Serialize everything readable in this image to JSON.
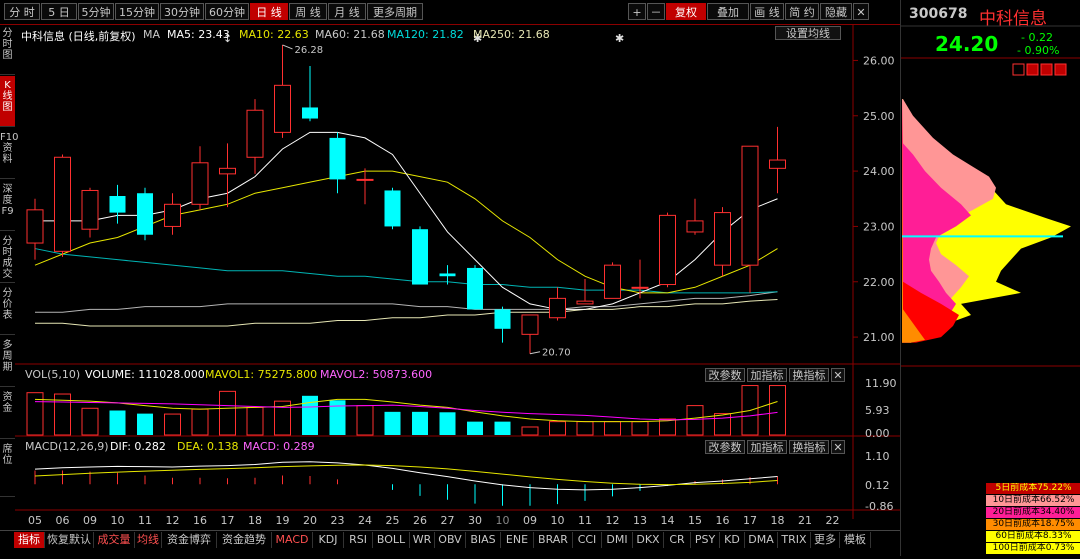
{
  "toolbar": {
    "left": [
      "分 时",
      "5 日",
      "5分钟",
      "15分钟",
      "30分钟",
      "60分钟",
      "日 线",
      "周 线",
      "月 线",
      "更多周期"
    ],
    "right": [
      "+",
      "－",
      "复权",
      "叠加",
      "画 线",
      "简 约",
      "隐藏",
      "✕"
    ],
    "active_left": "日 线"
  },
  "leftbar": [
    "分时图",
    "K线图",
    "F10资料",
    "深度F9",
    "分时成交",
    "分价表",
    "多周期",
    "资金",
    "席位"
  ],
  "legend": {
    "title": "中科信息 (日线,前复权)",
    "ma": "MA",
    "ma5": "MA5: 23.43",
    "ma10": "MA10: 22.63",
    "ma60": "MA60: 21.68",
    "ma120": "MA120: 21.82",
    "ma250": "MA250: 21.68",
    "settings": "设置均线"
  },
  "vol_legend": {
    "name": "VOL(5,10)",
    "volume": "VOLUME: 111028.000",
    "mavol1": "MAVOL1: 75275.800",
    "mavol2": "MAVOL2: 50873.600"
  },
  "macd_legend": {
    "name": "MACD(12,26,9)",
    "dif": "DIF: 0.282",
    "dea": "DEA: 0.138",
    "macd": "MACD: 0.289"
  },
  "panel_buttons": {
    "params": "改参数",
    "add": "加指标",
    "switch": "换指标",
    "close": "✕"
  },
  "annotations": {
    "high": "26.28",
    "low": "20.70"
  },
  "price_axis": [
    "26.00",
    "25.00",
    "24.00",
    "23.00",
    "22.00",
    "21.00"
  ],
  "vol_axis": [
    "11.90",
    "5.93",
    "0.00"
  ],
  "macd_axis": [
    "1.10",
    "0.12",
    "-0.86"
  ],
  "dates": [
    "05",
    "06",
    "09",
    "10",
    "11",
    "12",
    "16",
    "17",
    "18",
    "19",
    "20",
    "23",
    "24",
    "25",
    "26",
    "27",
    "30",
    "10",
    "09",
    "10",
    "11",
    "12",
    "13",
    "14",
    "15",
    "16",
    "17",
    "18",
    "21",
    "22"
  ],
  "bottom_tabs": [
    "指标",
    "恢复默认",
    "成交量",
    "均线",
    "资金博弈",
    "资金趋势",
    "MACD",
    "KDJ",
    "RSI",
    "BOLL",
    "WR",
    "OBV",
    "BIAS",
    "ENE",
    "BRAR",
    "CCI",
    "DMI",
    "DKX",
    "CR",
    "PSY",
    "KD",
    "DMA",
    "TRIX",
    "更多",
    "模板"
  ],
  "stock": {
    "code": "300678",
    "name": "中科信息",
    "price": "24.20",
    "change": "- 0.22",
    "pct": "- 0.90%"
  },
  "cost_legend": [
    "5日前成本75.22%",
    "10日前成本66.52%",
    "20日前成本34.40%",
    "30日前成本18.75%",
    "60日前成本8.33%",
    "100日前成本0.73%"
  ],
  "colors": {
    "up": "#ff3030",
    "down": "#00ffff",
    "accent": "#c00000",
    "ma5": "#ffffff",
    "ma10": "#e6e600",
    "ma60": "#00b4b4",
    "ma120": "#b4b4b4",
    "ma250": "#e6e6b4",
    "mavol2": "#ff00ff"
  },
  "chart_data": {
    "type": "candlestick",
    "candles": [
      {
        "date": "05",
        "o": 22.7,
        "h": 23.5,
        "l": 22.4,
        "c": 23.3
      },
      {
        "date": "06",
        "o": 22.55,
        "h": 24.3,
        "l": 22.45,
        "c": 24.25
      },
      {
        "date": "09",
        "o": 22.95,
        "h": 23.7,
        "l": 22.8,
        "c": 23.65
      },
      {
        "date": "10",
        "o": 23.55,
        "h": 23.75,
        "l": 23.05,
        "c": 23.25
      },
      {
        "date": "11",
        "o": 23.6,
        "h": 23.7,
        "l": 22.75,
        "c": 22.85
      },
      {
        "date": "12",
        "o": 23.0,
        "h": 23.6,
        "l": 22.85,
        "c": 23.4
      },
      {
        "date": "16",
        "o": 23.4,
        "h": 24.45,
        "l": 23.3,
        "c": 24.15
      },
      {
        "date": "17",
        "o": 23.95,
        "h": 24.5,
        "l": 23.35,
        "c": 24.05
      },
      {
        "date": "18",
        "o": 24.25,
        "h": 25.3,
        "l": 23.95,
        "c": 25.1
      },
      {
        "date": "19",
        "o": 24.7,
        "h": 26.28,
        "l": 24.6,
        "c": 25.55
      },
      {
        "date": "20",
        "o": 25.15,
        "h": 25.9,
        "l": 24.9,
        "c": 24.95
      },
      {
        "date": "23",
        "o": 24.6,
        "h": 24.7,
        "l": 23.6,
        "c": 23.85
      },
      {
        "date": "24",
        "o": 23.85,
        "h": 24.05,
        "l": 23.4,
        "c": 23.85
      },
      {
        "date": "25",
        "o": 23.65,
        "h": 23.7,
        "l": 22.95,
        "c": 23.0
      },
      {
        "date": "26",
        "o": 22.95,
        "h": 23.0,
        "l": 21.95,
        "c": 21.95
      },
      {
        "date": "27",
        "o": 22.15,
        "h": 22.3,
        "l": 21.95,
        "c": 22.1
      },
      {
        "date": "30",
        "o": 22.25,
        "h": 22.3,
        "l": 21.5,
        "c": 21.5
      },
      {
        "date": "10",
        "o": 21.5,
        "h": 21.55,
        "l": 20.9,
        "c": 21.15
      },
      {
        "date": "09",
        "o": 21.05,
        "h": 21.4,
        "l": 20.7,
        "c": 21.4
      },
      {
        "date": "10",
        "o": 21.35,
        "h": 21.9,
        "l": 21.3,
        "c": 21.7
      },
      {
        "date": "11",
        "o": 21.6,
        "h": 22.05,
        "l": 21.6,
        "c": 21.65
      },
      {
        "date": "12",
        "o": 21.7,
        "h": 22.35,
        "l": 21.7,
        "c": 22.3
      },
      {
        "date": "13",
        "o": 21.9,
        "h": 22.4,
        "l": 21.7,
        "c": 21.9
      },
      {
        "date": "14",
        "o": 21.95,
        "h": 23.25,
        "l": 21.9,
        "c": 23.2
      },
      {
        "date": "15",
        "o": 22.9,
        "h": 23.5,
        "l": 22.85,
        "c": 23.1
      },
      {
        "date": "16",
        "o": 22.3,
        "h": 23.35,
        "l": 22.1,
        "c": 23.25
      },
      {
        "date": "17",
        "o": 22.3,
        "h": 24.45,
        "l": 21.8,
        "c": 24.45
      },
      {
        "date": "18",
        "o": 24.05,
        "h": 24.8,
        "l": 23.6,
        "c": 24.2
      }
    ],
    "ma5": [
      23.1,
      23.1,
      23.1,
      23.2,
      23.2,
      23.3,
      23.5,
      23.6,
      23.9,
      24.4,
      24.7,
      24.7,
      24.6,
      24.3,
      23.6,
      22.9,
      22.4,
      21.9,
      21.6,
      21.5,
      21.5,
      21.6,
      21.8,
      22.0,
      22.4,
      22.9,
      23.3,
      23.5
    ],
    "ma10": [
      22.3,
      22.5,
      22.7,
      22.8,
      23.0,
      23.2,
      23.3,
      23.4,
      23.6,
      23.7,
      23.8,
      23.9,
      24.0,
      24.0,
      23.9,
      23.8,
      23.5,
      23.1,
      22.8,
      22.4,
      22.1,
      21.9,
      21.8,
      21.8,
      21.9,
      22.1,
      22.3,
      22.6
    ],
    "ma60": [
      22.6,
      22.5,
      22.45,
      22.4,
      22.35,
      22.3,
      22.25,
      22.2,
      22.2,
      22.2,
      22.15,
      22.1,
      22.1,
      22.05,
      22.0,
      22.0,
      21.95,
      21.95,
      21.9,
      21.9,
      21.85,
      21.85,
      21.85,
      21.8,
      21.8,
      21.8,
      21.8,
      21.82
    ],
    "ma120": [
      21.45,
      21.45,
      21.5,
      21.5,
      21.55,
      21.55,
      21.55,
      21.6,
      21.6,
      21.6,
      21.6,
      21.6,
      21.6,
      21.6,
      21.55,
      21.55,
      21.5,
      21.5,
      21.5,
      21.5,
      21.55,
      21.55,
      21.6,
      21.65,
      21.7,
      21.7,
      21.75,
      21.82
    ],
    "ma250": [
      21.25,
      21.25,
      21.2,
      21.2,
      21.2,
      21.2,
      21.2,
      21.2,
      21.25,
      21.25,
      21.25,
      21.3,
      21.3,
      21.35,
      21.35,
      21.4,
      21.4,
      21.45,
      21.45,
      21.45,
      21.5,
      21.5,
      21.55,
      21.55,
      21.6,
      21.6,
      21.65,
      21.68
    ],
    "volume": [
      95000,
      92000,
      60000,
      55000,
      48000,
      47000,
      58000,
      98000,
      62000,
      76000,
      88000,
      78000,
      66000,
      52000,
      52000,
      51000,
      30000,
      30000,
      18000,
      30000,
      30000,
      30000,
      30000,
      36000,
      66000,
      48000,
      111028,
      111028
    ],
    "mavol1": [
      80000,
      78000,
      76000,
      72000,
      66000,
      60000,
      58000,
      60000,
      62000,
      64000,
      73000,
      80000,
      80000,
      74000,
      67000,
      62000,
      52000,
      43000,
      36000,
      32000,
      30000,
      30000,
      30000,
      32000,
      38000,
      45000,
      55000,
      75275
    ],
    "mavol2": [
      75000,
      74000,
      73000,
      72000,
      71000,
      70000,
      68000,
      66000,
      64000,
      62000,
      63000,
      65000,
      66000,
      67000,
      64000,
      60000,
      55000,
      51000,
      48000,
      46000,
      44000,
      40000,
      36000,
      34000,
      35000,
      38000,
      43000,
      50873
    ],
    "dif": [
      0.55,
      0.6,
      0.63,
      0.65,
      0.64,
      0.63,
      0.66,
      0.68,
      0.72,
      0.8,
      0.82,
      0.78,
      0.7,
      0.58,
      0.42,
      0.28,
      0.12,
      -0.02,
      -0.12,
      -0.18,
      -0.2,
      -0.18,
      -0.12,
      -0.04,
      0.06,
      0.12,
      0.2,
      0.282
    ],
    "dea": [
      0.3,
      0.35,
      0.4,
      0.44,
      0.48,
      0.51,
      0.54,
      0.57,
      0.6,
      0.64,
      0.67,
      0.69,
      0.7,
      0.68,
      0.63,
      0.56,
      0.47,
      0.37,
      0.27,
      0.18,
      0.1,
      0.04,
      0.0,
      -0.01,
      0.0,
      0.03,
      0.07,
      0.138
    ],
    "ylim_price": [
      20.55,
      26.55
    ],
    "ylim_vol": [
      0,
      119000
    ],
    "ylim_macd": [
      -0.86,
      1.1
    ]
  }
}
